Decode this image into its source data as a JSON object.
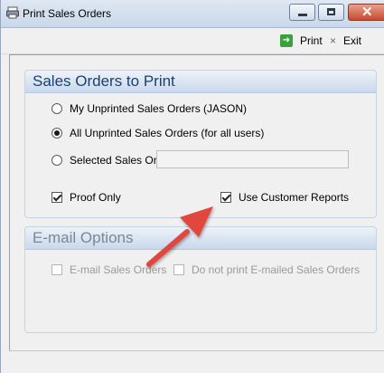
{
  "window": {
    "title": "Print Sales Orders"
  },
  "toolbar": {
    "print_label": "Print",
    "exit_label": "Exit"
  },
  "sales_orders_group": {
    "title": "Sales Orders to Print",
    "options": [
      {
        "label": "My Unprinted Sales Orders (JASON)",
        "selected": false
      },
      {
        "label": "All Unprinted Sales Orders (for all users)",
        "selected": true
      },
      {
        "label": "Selected Sales Orders",
        "selected": false
      }
    ],
    "selected_orders_value": "",
    "proof_only_label": "Proof Only",
    "use_customer_reports_label": "Use Customer Reports"
  },
  "email_group": {
    "title": "E-mail Options",
    "email_sales_orders_label": "E-mail Sales Orders",
    "do_not_print_label": "Do not print E-mailed Sales Orders"
  },
  "colors": {
    "accent_arrow": "#e2473c",
    "group_header": "#1e3f6e"
  }
}
